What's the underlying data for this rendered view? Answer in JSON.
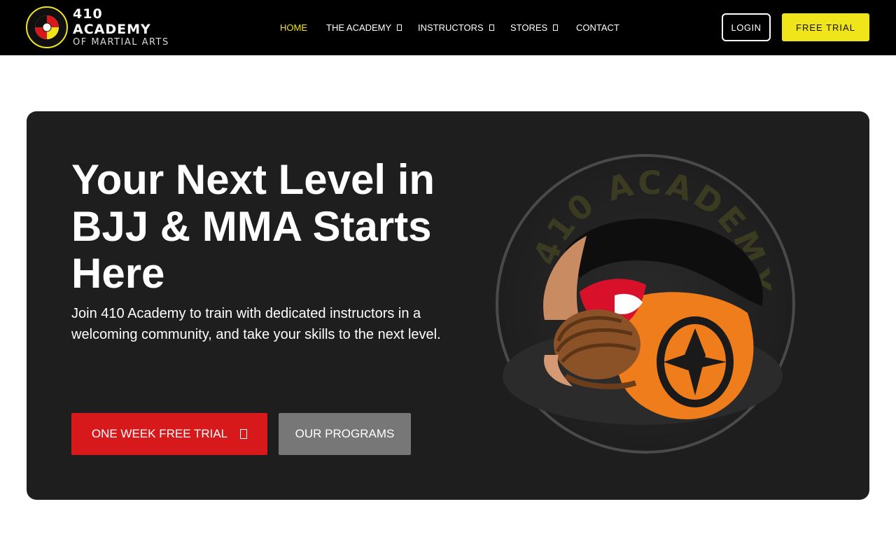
{
  "brand": {
    "name_line1": "410 ACADEMY",
    "name_line2": "OF MARTIAL ARTS",
    "accent": "#f0e51a"
  },
  "nav": {
    "items": [
      {
        "label": "HOME",
        "active": true
      },
      {
        "label": "THE ACADEMY",
        "dropdown": true
      },
      {
        "label": "INSTRUCTORS",
        "dropdown": true
      },
      {
        "label": "STORES",
        "dropdown": true
      },
      {
        "label": "CONTACT"
      }
    ],
    "login_label": "LOGIN",
    "free_trial_label": "FREE TRIAL"
  },
  "hero": {
    "title": "Your Next Level in BJJ & MMA Starts Here",
    "subtitle": "Join 410 Academy to train with dedicated instructors in a welcoming community, and take your skills to the next level.",
    "primary_cta": "ONE WEEK FREE TRIAL",
    "secondary_cta": "OUR PROGRAMS",
    "image_ring_text": "410 ACADEMY",
    "colors": {
      "background": "#1e1e1e",
      "primary_button": "#d7191c",
      "secondary_button": "#777777"
    }
  }
}
